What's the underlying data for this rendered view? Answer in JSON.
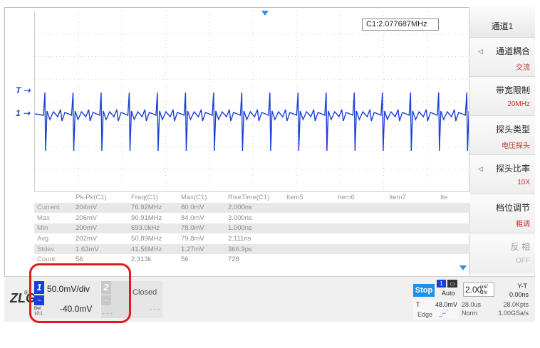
{
  "measure_freq": "C1:2.077687MHz",
  "markers": {
    "trigger": "T",
    "channel1": "1"
  },
  "menu": {
    "title": "通道1",
    "items": [
      {
        "label": "通道耦合",
        "value": "交流",
        "arrow": "◁"
      },
      {
        "label": "带宽限制",
        "value": "20MHz",
        "arrow": ""
      },
      {
        "label": "探头类型",
        "value": "电压探头",
        "arrow": ""
      },
      {
        "label": "探头比率",
        "value": "10X",
        "arrow": "◁"
      },
      {
        "label": "档位调节",
        "value": "粗调",
        "arrow": ""
      },
      {
        "label": "反 相",
        "value": "OFF",
        "arrow": "",
        "disabled": true
      }
    ]
  },
  "table": {
    "headers": [
      "",
      "Pk-Pk(C1)",
      "Freq(C1)",
      "Max(C1)",
      "RiseTime(C1)",
      "Item5",
      "Item6",
      "Item7",
      "Ite"
    ],
    "rows": [
      [
        "Current",
        "204mV",
        "76.92MHz",
        "80.0mV",
        "2.000ns",
        "",
        "",
        "",
        ""
      ],
      [
        "Max",
        "206mV",
        "90.91MHz",
        "84.0mV",
        "3.000ns",
        "",
        "",
        "",
        ""
      ],
      [
        "Min",
        "200mV",
        "693.0kHz",
        "78.0mV",
        "1.000ns",
        "",
        "",
        "",
        ""
      ],
      [
        "Avg",
        "202mV",
        "50.89MHz",
        "79.8mV",
        "2.111ns",
        "",
        "",
        "",
        ""
      ],
      [
        "Stdev",
        "1.63mV",
        "41.56MHz",
        "1.27mV",
        "366.9ps",
        "",
        "",
        "",
        ""
      ],
      [
        "Count",
        "56",
        "2.313k",
        "56",
        "728",
        "",
        "",
        "",
        ""
      ]
    ]
  },
  "bottom": {
    "logo": "ZLG",
    "logo_reg": "®",
    "ch1": {
      "num": "1",
      "scale": "50.0mV/div",
      "offset": "-40.0mV",
      "probe": "Bwl 10:1",
      "icon": "~"
    },
    "ch2": {
      "num": "2",
      "icon": "-",
      "dots": "- - -"
    },
    "ref": {
      "status": "Closed",
      "dots": "- - -"
    },
    "run": {
      "stop": "Stop",
      "channel_badge": "1",
      "mode": "Auto",
      "trig_label": "T",
      "trig_level": "48.0mV",
      "trig_type": "Edge"
    },
    "timebase": {
      "value": "2.00",
      "unit_top": "us/",
      "unit_bot": "div",
      "yt": "Y-T",
      "delay": "0.00ns",
      "mem_time": "28.0us",
      "mem_pts": "28.0Kpts",
      "acq_mode": "Norm",
      "rate": "1.00GSa/s"
    }
  },
  "colors": {
    "trace": "#1a3fd6",
    "accent": "#1e90e8",
    "highlight": "#e01b1b",
    "menu_value": "#c0392b"
  }
}
